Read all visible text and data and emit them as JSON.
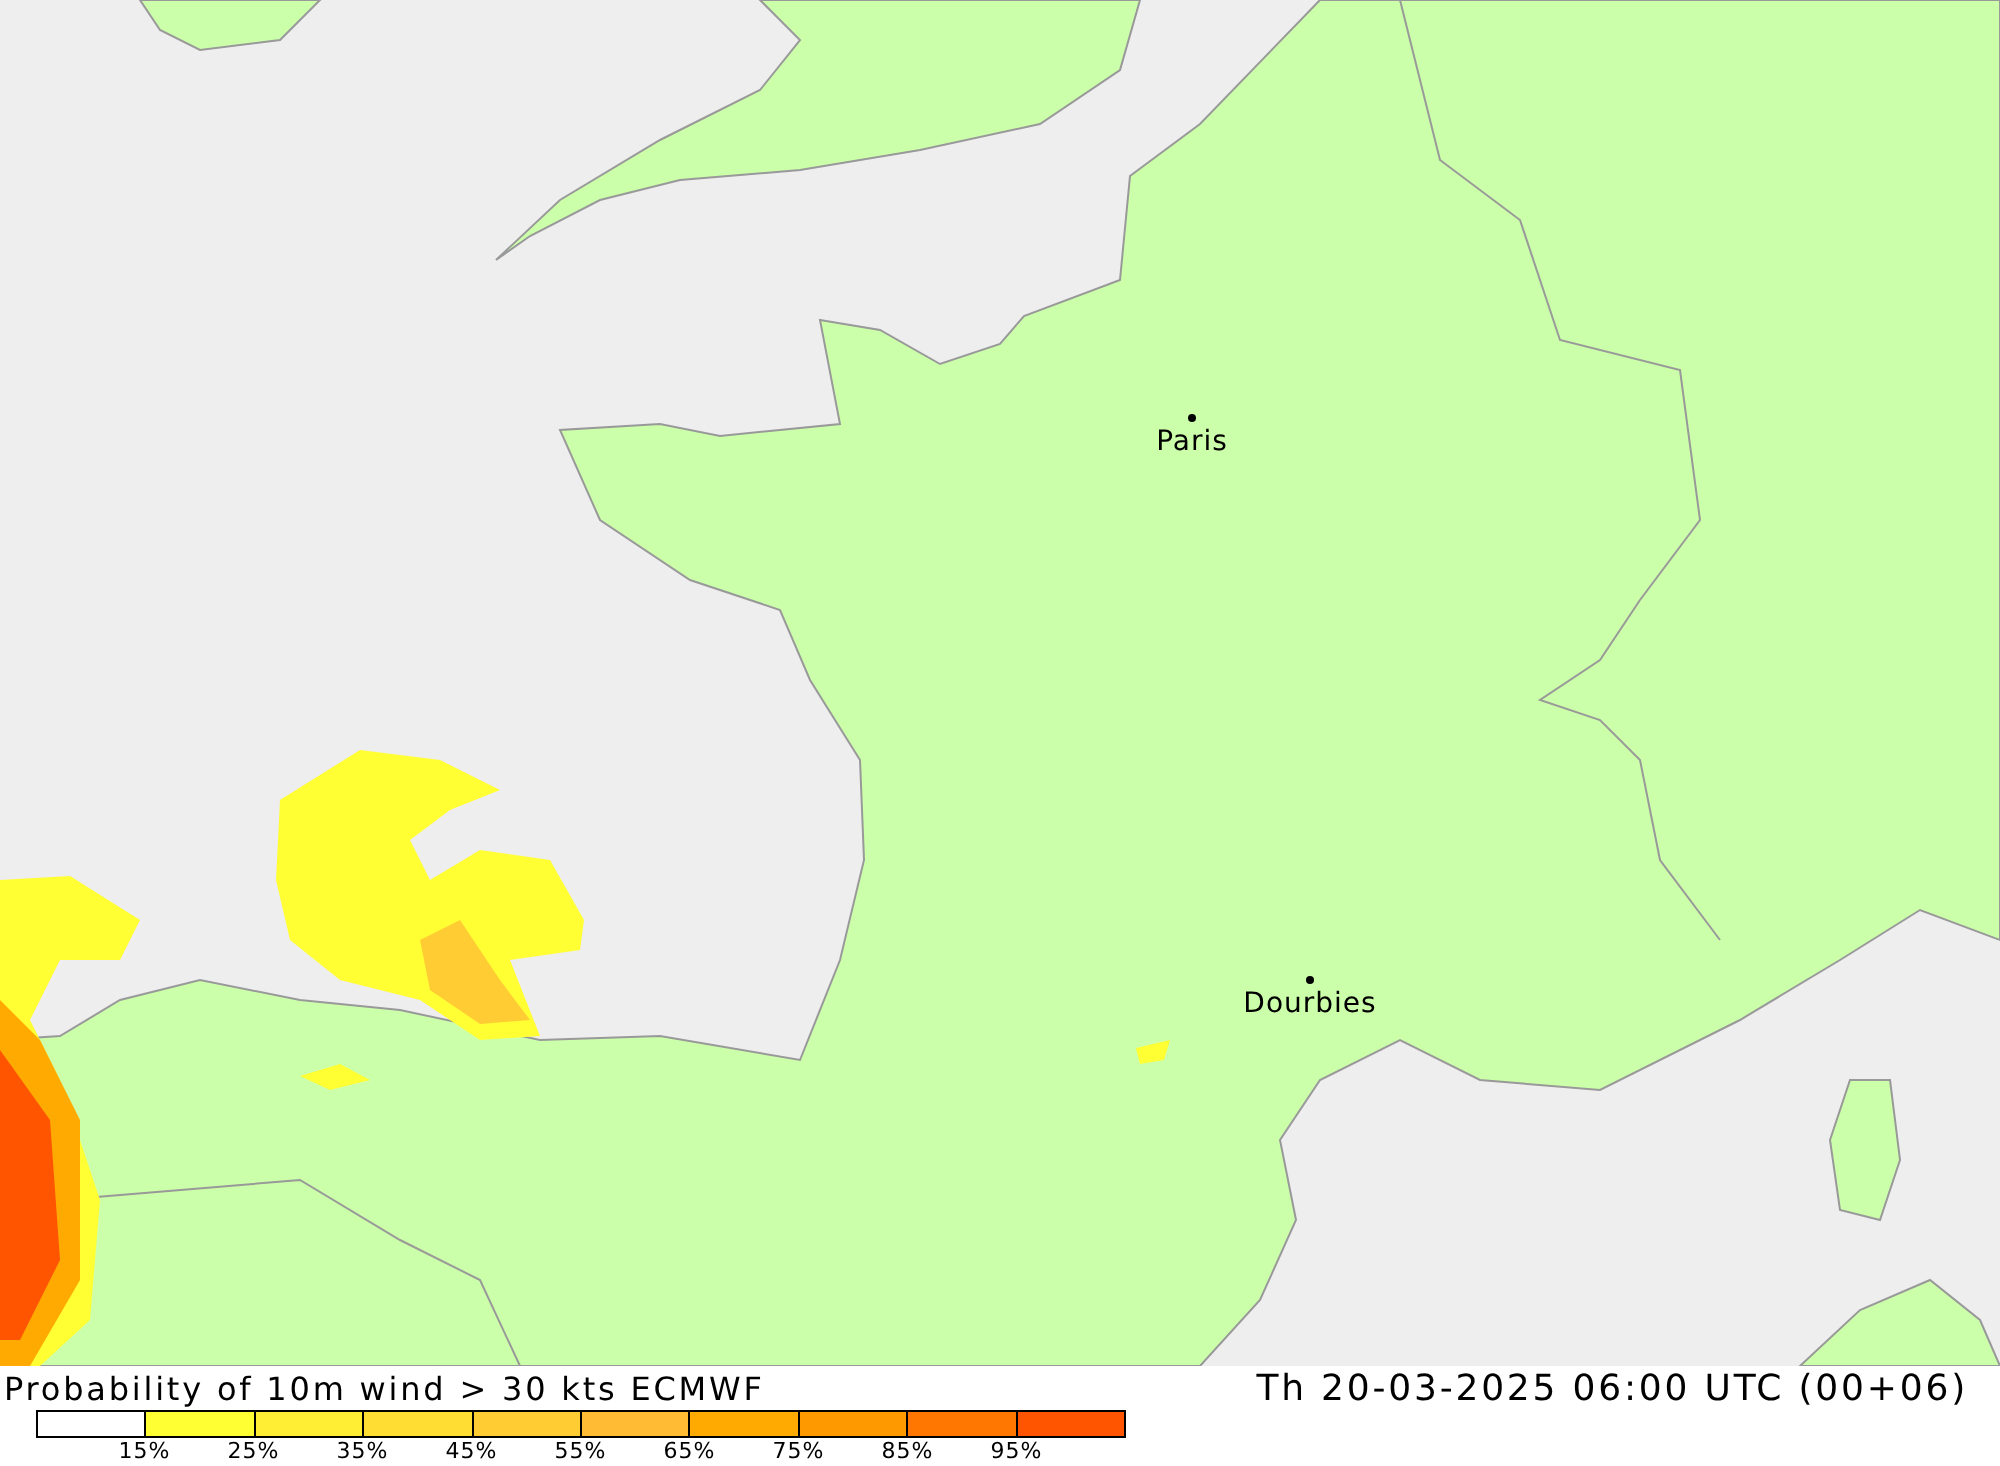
{
  "map": {
    "cities": [
      {
        "name": "Paris",
        "kind": "city"
      },
      {
        "name": "Dourbies",
        "kind": "city"
      }
    ]
  },
  "footer": {
    "title": "Probability of 10m wind > 30 kts ECMWF",
    "valid_time": "Th 20-03-2025 06:00 UTC (00+06)",
    "legend": {
      "swatches": [
        {
          "color": "#ffffff"
        },
        {
          "color": "#ffff33"
        },
        {
          "color": "#ffee33"
        },
        {
          "color": "#ffdd33"
        },
        {
          "color": "#ffcc33"
        },
        {
          "color": "#ffbb33"
        },
        {
          "color": "#ffaa00"
        },
        {
          "color": "#ff9900"
        },
        {
          "color": "#ff7700"
        },
        {
          "color": "#ff5500"
        }
      ],
      "labels": [
        "15%",
        "25%",
        "35%",
        "45%",
        "55%",
        "65%",
        "75%",
        "85%",
        "95%"
      ]
    }
  }
}
